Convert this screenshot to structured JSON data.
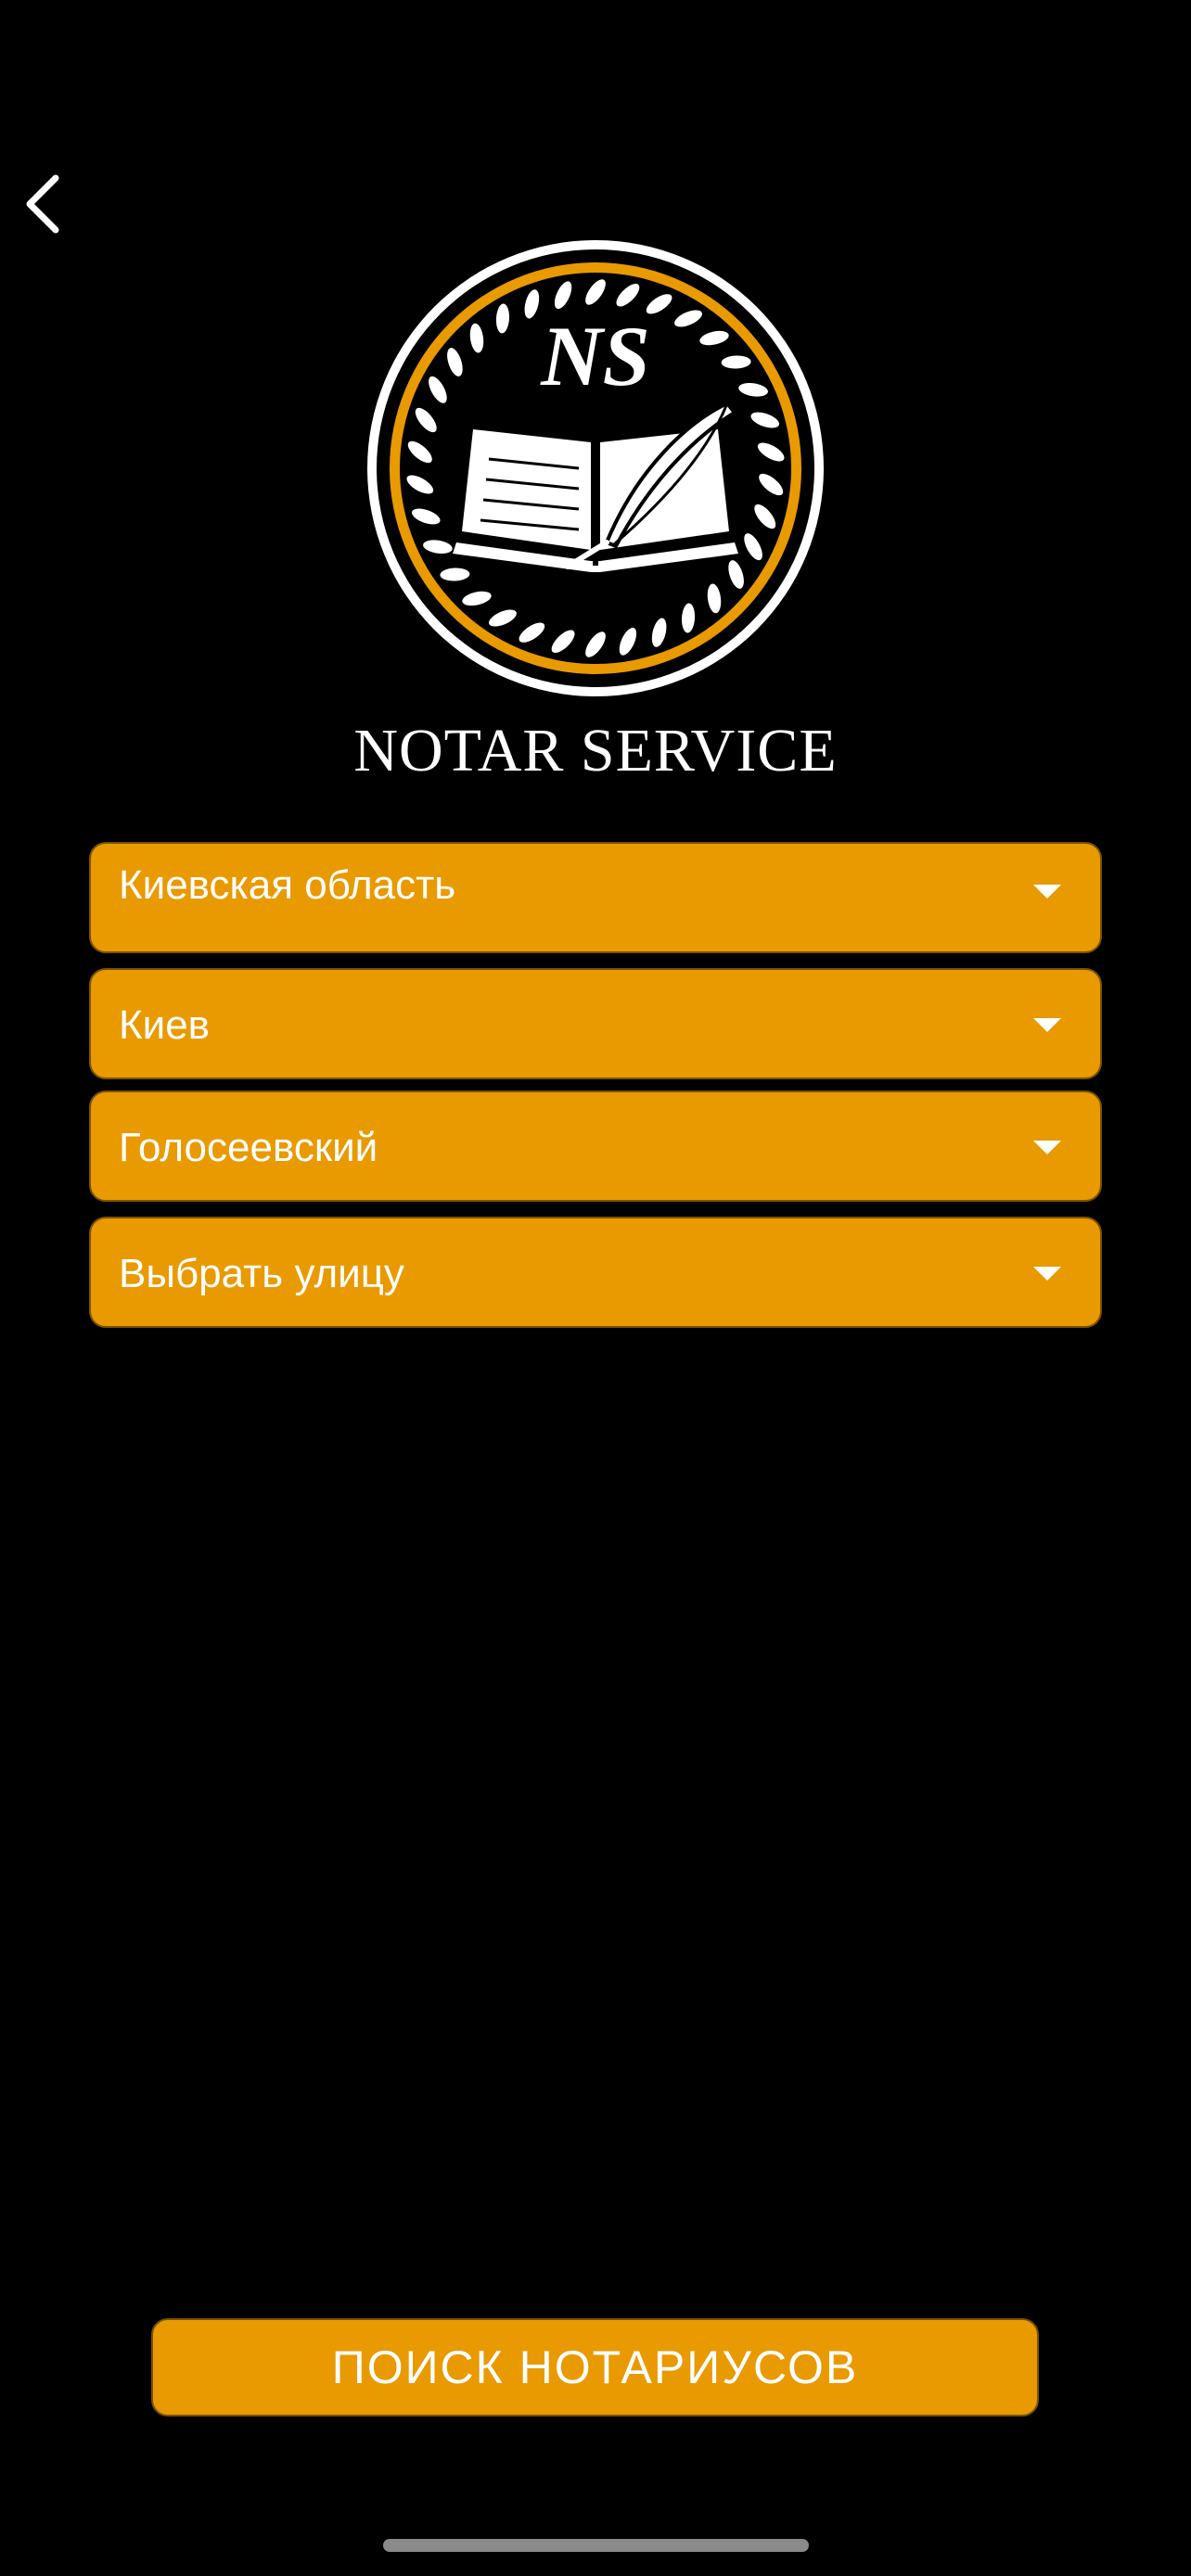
{
  "header": {
    "back_icon": "chevron-left-icon"
  },
  "brand": {
    "name": "NOTAR SERVICE",
    "logo_icon": "notary-seal-logo",
    "accent_color": "#e89a00"
  },
  "filters": {
    "region": "Киевская область",
    "city": "Киев",
    "district": "Голосеевский",
    "street_placeholder": "Выбрать улицу"
  },
  "actions": {
    "search_label": "ПОИСК НОТАРИУСОВ"
  }
}
